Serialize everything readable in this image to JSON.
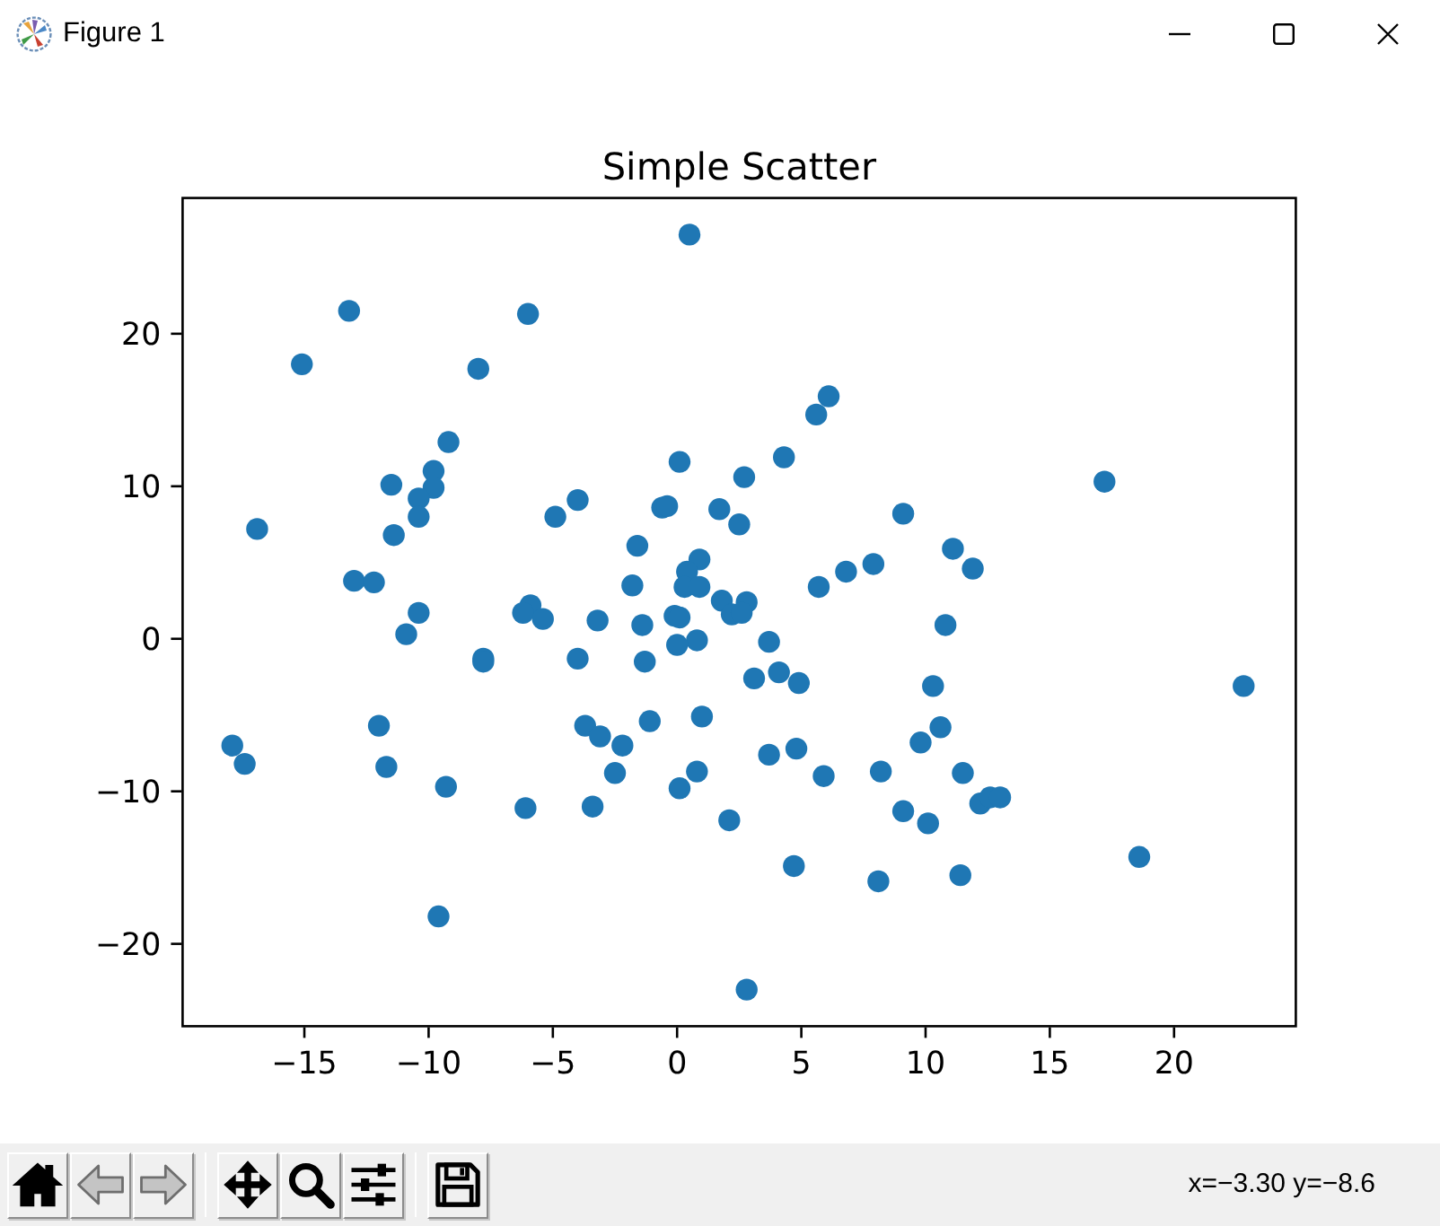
{
  "window": {
    "title": "Figure 1"
  },
  "figure": {
    "chart_data": {
      "type": "scatter",
      "title": "Simple Scatter",
      "x": [
        0.5,
        -13.2,
        -6.0,
        -15.1,
        -8.0,
        -9.2,
        0.1,
        -9.8,
        -11.5,
        -9.8,
        2.7,
        -10.4,
        -4.0,
        -0.6,
        -0.4,
        1.7,
        -4.9,
        -10.4,
        -16.9,
        2.5,
        -11.4,
        -1.6,
        0.9,
        0.4,
        -13.0,
        -12.2,
        -1.8,
        0.3,
        0.9,
        1.8,
        2.8,
        2.2,
        2.6,
        -10.4,
        -5.9,
        -6.2,
        -5.4,
        -3.2,
        -1.4,
        -0.1,
        0.1,
        -10.9,
        0.8,
        0.0,
        3.7,
        6.1,
        5.6,
        4.3,
        17.2,
        9.1,
        11.1,
        11.9,
        7.9,
        6.8,
        5.7,
        10.8,
        -7.8,
        -7.8,
        -4.0,
        -1.3,
        3.1,
        4.1,
        4.9,
        10.3,
        22.8,
        -12.0,
        -3.7,
        -3.1,
        -1.1,
        1.0,
        -2.2,
        -17.9,
        -17.4,
        -11.7,
        -2.5,
        0.8,
        -9.3,
        0.1,
        -6.1,
        -3.4,
        2.1,
        -9.6,
        2.8,
        10.6,
        9.8,
        3.7,
        4.8,
        5.9,
        8.2,
        11.5,
        12.2,
        12.6,
        13.0,
        9.1,
        10.1,
        4.7,
        8.1,
        11.4,
        18.6
      ],
      "series": [
        {
          "color": "#1f77b4",
          "values": [
            26.5,
            21.5,
            21.3,
            18.0,
            17.7,
            12.9,
            11.6,
            11.0,
            10.1,
            9.9,
            10.6,
            9.2,
            9.1,
            8.6,
            8.7,
            8.5,
            8.0,
            8.0,
            7.2,
            7.5,
            6.8,
            6.1,
            5.2,
            4.4,
            3.8,
            3.7,
            3.5,
            3.4,
            3.4,
            2.5,
            2.4,
            1.6,
            1.7,
            1.7,
            2.2,
            1.7,
            1.3,
            1.2,
            0.9,
            1.5,
            1.4,
            0.3,
            -0.1,
            -0.4,
            -0.2,
            15.9,
            14.7,
            11.9,
            10.3,
            8.2,
            5.9,
            4.6,
            4.9,
            4.4,
            3.4,
            0.9,
            -1.3,
            -1.5,
            -1.3,
            -1.5,
            -2.6,
            -2.2,
            -2.9,
            -3.1,
            -3.1,
            -5.7,
            -5.7,
            -6.4,
            -5.4,
            -5.1,
            -7.0,
            -7.0,
            -8.2,
            -8.4,
            -8.8,
            -8.7,
            -9.7,
            -9.8,
            -11.1,
            -11.0,
            -11.9,
            -18.2,
            -23.0,
            -5.8,
            -6.8,
            -7.6,
            -7.2,
            -9.0,
            -8.7,
            -8.8,
            -10.8,
            -10.4,
            -10.4,
            -11.3,
            -12.1,
            -14.9,
            -15.9,
            -15.5,
            -14.3
          ]
        }
      ],
      "xlim": [
        -19.9,
        24.9
      ],
      "ylim": [
        -25.4,
        28.9
      ],
      "xticks": [
        {
          "value": -15,
          "label": "−15"
        },
        {
          "value": -10,
          "label": "−10"
        },
        {
          "value": -5,
          "label": "−5"
        },
        0,
        5,
        10,
        15,
        20
      ],
      "yticks": [
        {
          "value": -20,
          "label": "−20"
        },
        {
          "value": -10,
          "label": "−10"
        },
        0,
        10,
        20
      ]
    }
  },
  "toolbar": {
    "groups": [
      [
        {
          "kind": "home",
          "disabled": false
        },
        {
          "kind": "back",
          "disabled": true
        },
        {
          "kind": "forward",
          "disabled": true
        }
      ],
      [
        {
          "kind": "pan",
          "disabled": false
        },
        {
          "kind": "zoom",
          "disabled": false
        },
        {
          "kind": "configure",
          "disabled": false
        }
      ],
      [
        {
          "kind": "save",
          "disabled": false
        }
      ]
    ],
    "readout": "x=−3.30 y=−8.6"
  }
}
